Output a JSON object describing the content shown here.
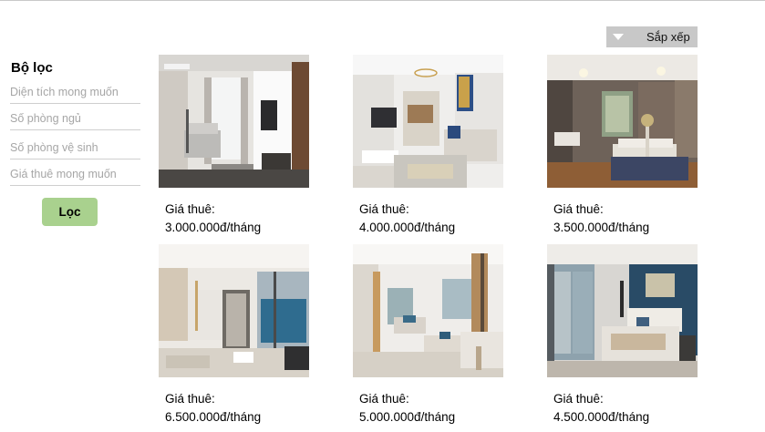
{
  "sort": {
    "label": "Sắp xếp"
  },
  "filter": {
    "title": "Bộ lọc",
    "fields": [
      "Diện tích mong muốn",
      "Số phòng ngủ",
      "Số phòng vệ sinh",
      "Giá thuê mong muốn"
    ],
    "button": "Lọc"
  },
  "listings": [
    {
      "price_label": "Giá thuê:",
      "price": "3.000.000đ/tháng"
    },
    {
      "price_label": "Giá thuê:",
      "price": "4.000.000đ/tháng"
    },
    {
      "price_label": "Giá thuê:",
      "price": "3.500.000đ/tháng"
    },
    {
      "price_label": "Giá thuê:",
      "price": "6.500.000đ/tháng"
    },
    {
      "price_label": "Giá thuê:",
      "price": "5.000.000đ/tháng"
    },
    {
      "price_label": "Giá thuê:",
      "price": "4.500.000đ/tháng"
    }
  ],
  "icons": {
    "sort": "triangle-down-icon"
  }
}
